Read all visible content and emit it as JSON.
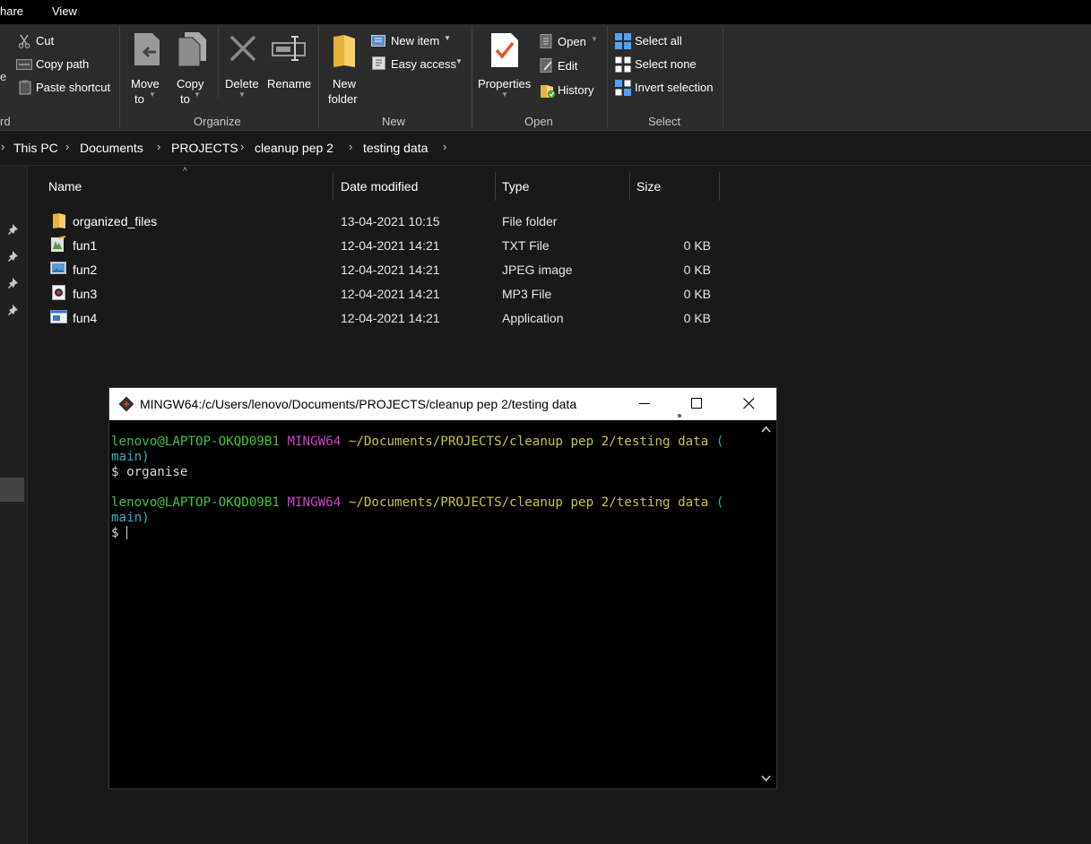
{
  "menu": {
    "tabs": [
      "hare",
      "View"
    ]
  },
  "ribbon": {
    "clipboard": {
      "cut": "Cut",
      "copy_path": "Copy path",
      "paste_shortcut": "Paste shortcut",
      "group": "rd",
      "left_frag": "e"
    },
    "organize": {
      "move_to": [
        "Move",
        "to"
      ],
      "copy_to": [
        "Copy",
        "to"
      ],
      "delete": "Delete",
      "rename": "Rename",
      "group": "Organize"
    },
    "new": {
      "new_folder": [
        "New",
        "folder"
      ],
      "new_item": "New item",
      "easy_access": "Easy access",
      "group": "New"
    },
    "open": {
      "properties": "Properties",
      "open": "Open",
      "edit": "Edit",
      "history": "History",
      "group": "Open"
    },
    "select": {
      "select_all": "Select all",
      "select_none": "Select none",
      "invert_selection": "Invert selection",
      "group": "Select"
    }
  },
  "breadcrumb": [
    "This PC",
    "Documents",
    "PROJECTS",
    "cleanup pep 2",
    "testing data"
  ],
  "columns": {
    "name": "Name",
    "date": "Date modified",
    "type": "Type",
    "size": "Size"
  },
  "files": [
    {
      "name": "organized_files",
      "date": "13-04-2021 10:15",
      "type": "File folder",
      "size": "",
      "icon": "folder-icon"
    },
    {
      "name": "fun1",
      "date": "12-04-2021 14:21",
      "type": "TXT File",
      "size": "0 KB",
      "icon": "text-file-icon"
    },
    {
      "name": "fun2",
      "date": "12-04-2021 14:21",
      "type": "JPEG image",
      "size": "0 KB",
      "icon": "image-file-icon"
    },
    {
      "name": "fun3",
      "date": "12-04-2021 14:21",
      "type": "MP3 File",
      "size": "0 KB",
      "icon": "audio-file-icon"
    },
    {
      "name": "fun4",
      "date": "12-04-2021 14:21",
      "type": "Application",
      "size": "0 KB",
      "icon": "application-file-icon"
    }
  ],
  "terminal": {
    "title": "MINGW64:/c/Users/lenovo/Documents/PROJECTS/cleanup pep 2/testing data",
    "user": "lenovo@LAPTOP-OKQD09B1",
    "shell": "MINGW64",
    "path": "~/Documents/PROJECTS/cleanup pep 2/testing data",
    "branch_open": "(",
    "branch": "main)",
    "prompt": "$",
    "command": "organise"
  },
  "colors": {
    "terminal_green": "#3fc43f",
    "terminal_magenta": "#c844c8",
    "terminal_yellow": "#c8c43f",
    "terminal_cyan": "#2fb0c0"
  }
}
